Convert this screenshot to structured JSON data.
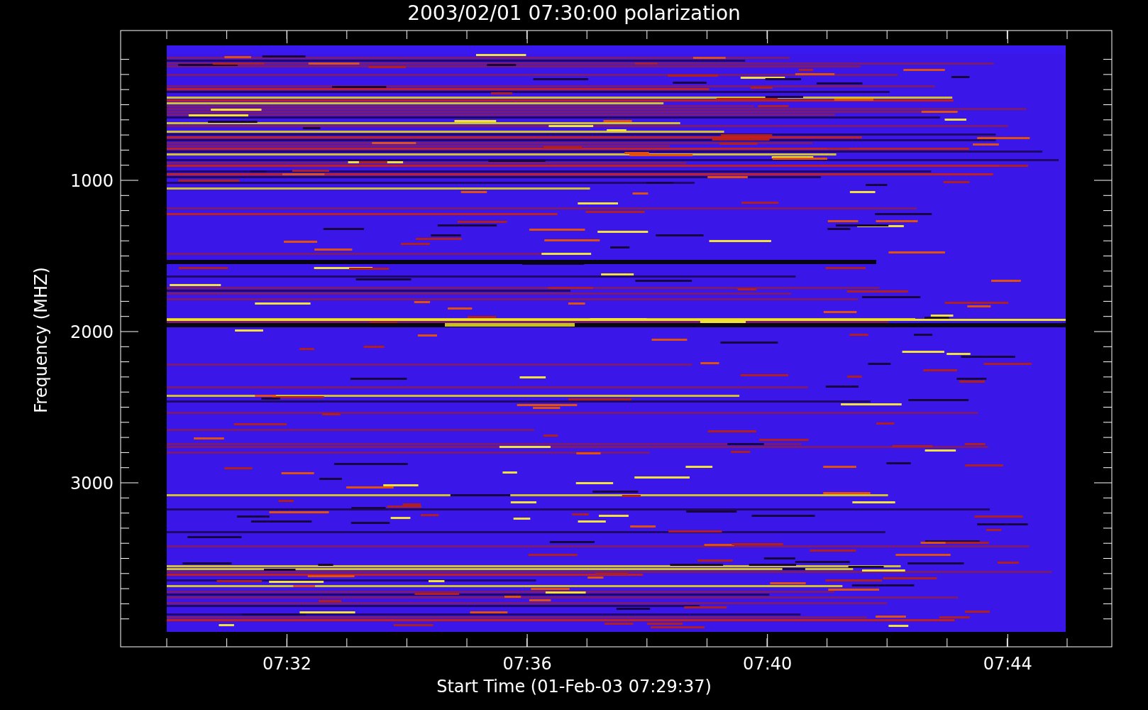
{
  "title": "2003/02/01 07:30:00 polarization",
  "y_axis": {
    "label": "Frequency (MHZ)",
    "ticks": [
      "1000",
      "2000",
      "3000"
    ]
  },
  "x_axis": {
    "label": "Start Time (01-Feb-03 07:29:37)",
    "ticks": [
      "07:32",
      "07:36",
      "07:40",
      "07:44"
    ]
  }
}
